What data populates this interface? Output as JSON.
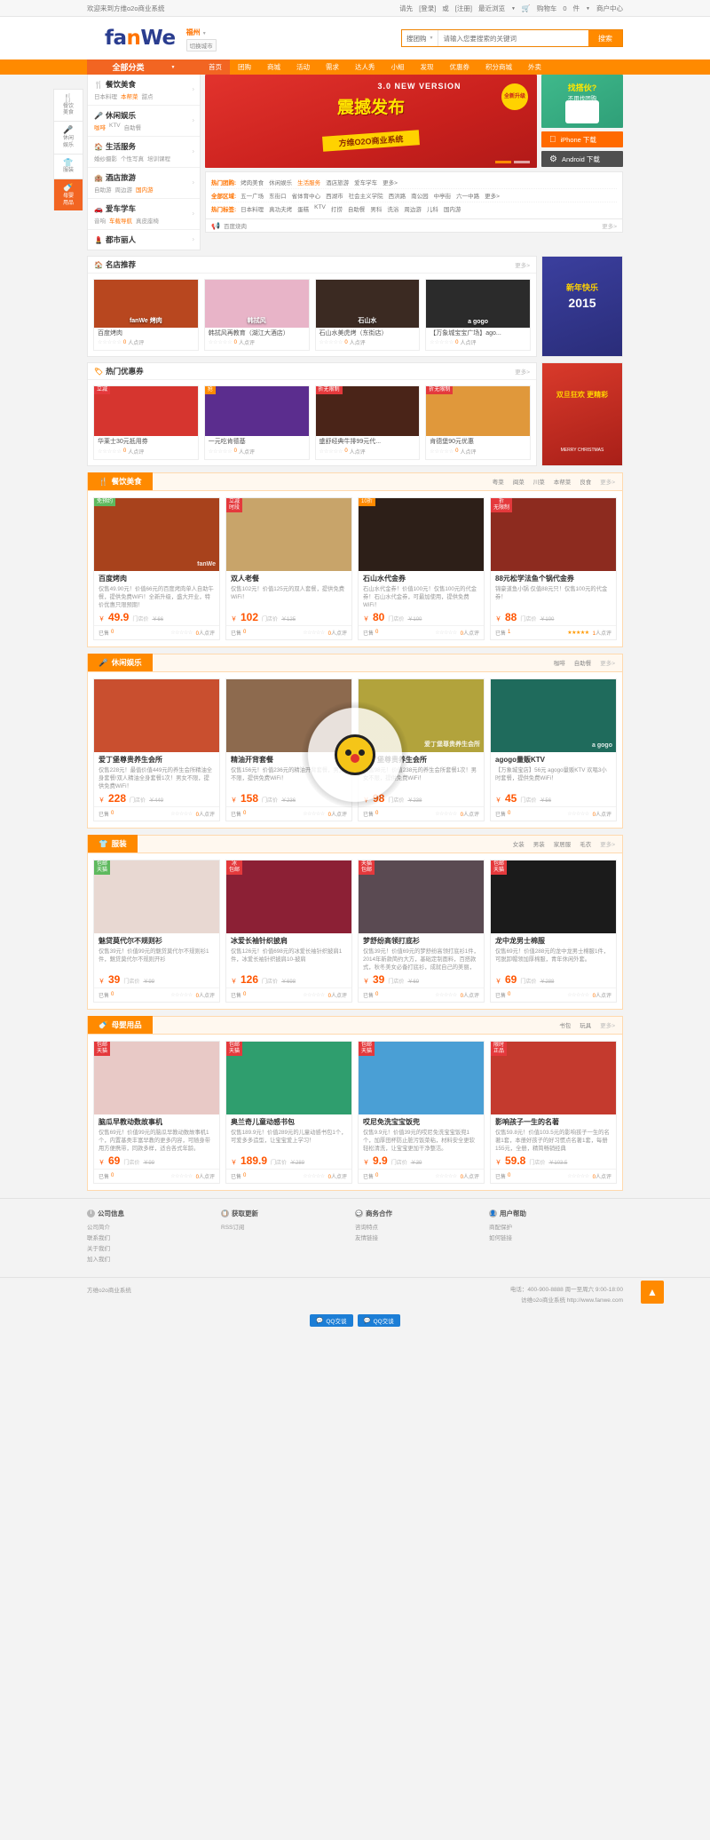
{
  "topbar": {
    "welcome": "欢迎来到方维o2o商业系统",
    "login_prefix": "请先",
    "login": "[登录]",
    "or": "或",
    "register": "[注册]",
    "recent": "最近浏览",
    "cart_label": "购物车",
    "cart_count": "0",
    "cart_unit": "件",
    "merchant_center": "商户中心"
  },
  "header": {
    "logo_a": "fa",
    "logo_o": "n",
    "logo_b": "We",
    "city": "福州",
    "switch_city": "切换城市",
    "search_type": "搜团购",
    "search_placeholder": "请输入您要搜索的关键词",
    "search_value": "",
    "search_button": "搜索"
  },
  "nav": {
    "all_categories": "全部分类",
    "items": [
      {
        "label": "首页",
        "active": true
      },
      {
        "label": "团购",
        "active": false
      },
      {
        "label": "商城",
        "active": false
      },
      {
        "label": "活动",
        "active": false
      },
      {
        "label": "需求",
        "active": false
      },
      {
        "label": "达人秀",
        "active": false
      },
      {
        "label": "小組",
        "active": false
      },
      {
        "label": "发现",
        "active": false
      },
      {
        "label": "优惠券",
        "active": false
      },
      {
        "label": "积分商城",
        "active": false
      },
      {
        "label": "外卖",
        "active": false
      }
    ]
  },
  "side_rail": [
    {
      "label": "餐饮美食",
      "icon": "🍴",
      "active": false
    },
    {
      "label": "休闲娱乐",
      "icon": "🎤",
      "active": false
    },
    {
      "label": "服装",
      "icon": "👕",
      "active": false
    },
    {
      "label": "母婴用品",
      "icon": "🍼",
      "active": true
    }
  ],
  "categories": [
    {
      "title": "餐饮美食",
      "icon": "🍴",
      "subs": [
        "日本料理",
        "本帮菜",
        "甜点"
      ],
      "hot_index": 1
    },
    {
      "title": "休闲娱乐",
      "icon": "🎤",
      "subs": [
        "咖啡",
        "KTV",
        "自助餐"
      ],
      "hot_index": 0
    },
    {
      "title": "生活服务",
      "icon": "🏠",
      "subs": [
        "婚纱摄影",
        "个性写真",
        "培训课程"
      ],
      "hot_index": -1
    },
    {
      "title": "酒店旅游",
      "icon": "🏨",
      "subs": [
        "自助游",
        "周边游",
        "国内游"
      ],
      "hot_index": 2
    },
    {
      "title": "爱车学车",
      "icon": "🚗",
      "subs": [
        "音响",
        "车载导航",
        "真皮座椅"
      ],
      "hot_index": 1
    },
    {
      "title": "都市丽人",
      "icon": "💄",
      "subs": [],
      "hot_index": -1
    }
  ],
  "banner": {
    "new_tag": "3.0 NEW VERSION",
    "title": "震撼发布",
    "subtitle": "方维O2O商业系统",
    "badge": "全新升级",
    "version": "3.0"
  },
  "right_ads": {
    "green_t1": "找搭伙?",
    "green_t2": "不用找团购",
    "ios_label": "iPhone 下载",
    "android_label": "Android 下载"
  },
  "hot_tags": {
    "rows": [
      {
        "label": "热门团购:",
        "tags": [
          "烤肉美食",
          "休闲娱乐",
          "生活服务",
          "酒店旅游",
          "爱车学车",
          "更多>"
        ],
        "on": 2
      },
      {
        "label": "全部区域:",
        "tags": [
          "五一广场",
          "东街口",
          "省体育中心",
          "西湖市",
          "社会主义学院",
          "西洪路",
          "南公园",
          "中亭街",
          "六一中路",
          "更多>"
        ],
        "on": -1
      },
      {
        "label": "热门标签:",
        "tags": [
          "日本料理",
          "真功夫烤",
          "蛋糕",
          "KTV",
          "打捞",
          "自助餐",
          "男科",
          "洗浴",
          "周边游",
          "儿科",
          "国内游"
        ],
        "on": -1
      }
    ],
    "notice": "百度烧肉",
    "notice_more": "更多>"
  },
  "shops": {
    "title": "名店推荐",
    "icon": "🏠",
    "more": "更多>",
    "cards": [
      {
        "name": "百度烤肉",
        "reviews": "0",
        "reviews_suffix": "人点评",
        "img": "#b8471f",
        "cap": "fanWe 烤肉"
      },
      {
        "name": "韩拭风再教育（湖江大酒店）",
        "reviews": "0",
        "reviews_suffix": "人点评",
        "img": "#e8b4c8",
        "cap": "韩拭风"
      },
      {
        "name": "石山水美虎烤（东街店）",
        "reviews": "0",
        "reviews_suffix": "人点评",
        "img": "#3b2a22",
        "cap": "石山水"
      },
      {
        "name": "【万象城宝宝广场】ago...",
        "reviews": "0",
        "reviews_suffix": "人点评",
        "img": "#2b2b2b",
        "cap": "a gogo"
      }
    ],
    "side_ad_title": "新年快乐",
    "side_ad_year": "2015"
  },
  "coupons": {
    "title": "热门优惠券",
    "icon": "🏷",
    "more": "更多>",
    "cards": [
      {
        "corner": "立减",
        "corner_color": "#e4393c",
        "name": "华莱士30元抵用券",
        "reviews": "0",
        "reviews_suffix": "人点评",
        "img": "#d6352f"
      },
      {
        "corner": "抢",
        "corner_color": "#ff8a00",
        "name": "一元吃肯德基",
        "reviews": "0",
        "reviews_suffix": "人点评",
        "img": "#5b2d8e"
      },
      {
        "corner": "折无限制",
        "corner_color": "#e4393c",
        "name": "盛舒经典牛排99元代...",
        "reviews": "0",
        "reviews_suffix": "人点评",
        "img": "#4a2418"
      },
      {
        "corner": "折无限制",
        "corner_color": "#e4393c",
        "name": "肯德堡90元优惠",
        "reviews": "0",
        "reviews_suffix": "人点评",
        "img": "#e0983b"
      }
    ],
    "side_ad_title": "双旦狂欢 更精彩",
    "side_ad_sub": "MERRY CHRISTMAS"
  },
  "sections": [
    {
      "id": "food",
      "title": "餐饮美食",
      "icon": "🍴",
      "filters": [
        "粤菜",
        "闽菜",
        "川菜",
        "本帮菜",
        "良食"
      ],
      "more": "更多>",
      "cards": [
        {
          "corner": "免预约",
          "corner_color": "#5eb95e",
          "title": "百度烤肉",
          "desc": "仅售49.90元！价值66元的百度烤肉单人自助午餐，提供免费WiFi！全新升级，盛大开业，特价优惠只限预期！",
          "price": "49.9",
          "old_label": "门店价",
          "old": "￥66",
          "sold_label": "已售",
          "sold": "0",
          "stars": 0,
          "reviews": "0",
          "reviews_suffix": "人点评",
          "img": "#a8421c",
          "cap": "fanWe"
        },
        {
          "corner": "立减 时段",
          "corner_color": "#e4393c",
          "title": "双人老餐",
          "desc": "仅售102元！价值125元的双人套餐，提供免费WiFi！",
          "price": "102",
          "old_label": "门店价",
          "old": "￥125",
          "sold_label": "已售",
          "sold": "0",
          "stars": 0,
          "reviews": "0",
          "reviews_suffix": "人点评",
          "img": "#c8a46a",
          "cap": ""
        },
        {
          "corner": "10折",
          "corner_color": "#ff8a00",
          "title": "石山水代金券",
          "desc": "石山水代金券！价值100元！仅售100元的代金券！石山水代金券，可最加使用，提供免费WiFi！",
          "price": "80",
          "old_label": "门店价",
          "old": "￥100",
          "sold_label": "已售",
          "sold": "0",
          "stars": 0,
          "reviews": "0",
          "reviews_suffix": "人点评",
          "img": "#2d1f18",
          "cap": ""
        },
        {
          "corner": "折 无限制",
          "corner_color": "#e4393c",
          "title": "88元松学法鱼个锅代金券",
          "desc": "锦豪道鱼小锅 仅值88元只！仅售100元的代金券！",
          "price": "88",
          "old_label": "门店价",
          "old": "￥100",
          "sold_label": "已售",
          "sold": "1",
          "stars": 5,
          "reviews": "1",
          "reviews_suffix": "人点评",
          "img": "#8d2b1f",
          "cap": ""
        }
      ]
    },
    {
      "id": "leisure",
      "title": "休闲娱乐",
      "icon": "🎤",
      "filters": [
        "咖啡",
        "自助餐"
      ],
      "more": "更多>",
      "cards": [
        {
          "corner": "",
          "corner_color": "",
          "title": "爱丁堡尊贵养生会所",
          "desc": "仅售228元！最值价值449元的养生会所精油全身套餐!双人精油全身套餐1次！男女不限，提供免费WiFi！",
          "price": "228",
          "old_label": "门店价",
          "old": "￥449",
          "sold_label": "已售",
          "sold": "0",
          "stars": 0,
          "reviews": "0",
          "reviews_suffix": "人点评",
          "img": "#c94f2f",
          "cap": ""
        },
        {
          "corner": "",
          "corner_color": "",
          "title": "精油开背套餐",
          "desc": "仅售156元！价值236元的精油开背套餐，男女不限，提供免费WiFi！",
          "price": "158",
          "old_label": "门店价",
          "old": "￥236",
          "sold_label": "已售",
          "sold": "0",
          "stars": 0,
          "reviews": "0",
          "reviews_suffix": "人点评",
          "img": "#8d6a4e",
          "cap": ""
        },
        {
          "corner": "",
          "corner_color": "",
          "title": "爱丁堡尊贵养生会所",
          "desc": "仅售98元！价值238元的养生会所套餐1次！男女不限，提供免费WiFi！",
          "price": "98",
          "old_label": "门店价",
          "old": "￥238",
          "sold_label": "已售",
          "sold": "0",
          "stars": 0,
          "reviews": "0",
          "reviews_suffix": "人点评",
          "img": "#b2a33c",
          "cap": "爱丁堡尊贵养生会所"
        },
        {
          "corner": "",
          "corner_color": "",
          "title": "agogo量贩KTV",
          "desc": "【万象城宝店】56元 agogo量贩KTV 欢唱3小时套餐，提供免费WiFi！",
          "price": "45",
          "old_label": "门店价",
          "old": "￥56",
          "sold_label": "已售",
          "sold": "0",
          "stars": 0,
          "reviews": "0",
          "reviews_suffix": "人点评",
          "img": "#1f6b5c",
          "cap": "a gogo"
        }
      ]
    },
    {
      "id": "clothes",
      "title": "服装",
      "icon": "👕",
      "filters": [
        "女装",
        "男装",
        "家居服",
        "毛衣"
      ],
      "more": "更多>",
      "cards": [
        {
          "corner": "包邮 天猫",
          "corner_color": "#5eb95e",
          "title": "魅贷莫代尔不规则衫",
          "desc": "仅售39元！价值99元的魅贷莫代尔不规则衫1件，魅贷莫代尔不规则开衫",
          "price": "39",
          "old_label": "门店价",
          "old": "￥99",
          "sold_label": "已售",
          "sold": "0",
          "stars": 0,
          "reviews": "0",
          "reviews_suffix": "人点评",
          "img": "#e8d8d2",
          "cap": ""
        },
        {
          "corner": "冰 包邮",
          "corner_color": "#e4393c",
          "title": "冰爱长袖针织披肩",
          "desc": "仅售126元！价值698元的冰爱长袖针织披肩1件，冰爱长袖针织披肩10-披肩",
          "price": "126",
          "old_label": "门店价",
          "old": "￥698",
          "sold_label": "已售",
          "sold": "0",
          "stars": 0,
          "reviews": "0",
          "reviews_suffix": "人点评",
          "img": "#8c2035",
          "cap": ""
        },
        {
          "corner": "天猫 包邮",
          "corner_color": "#e4393c",
          "title": "梦舒纷高领打底衫",
          "desc": "仅售39元！价值69元的梦舒纷高领打底衫1件，2014年新款简约大方，基础定制面料，百搭款式，秋冬美女必备打底衫，成就自己的美丽，就",
          "price": "39",
          "old_label": "门店价",
          "old": "￥69",
          "sold_label": "已售",
          "sold": "0",
          "stars": 0,
          "reviews": "0",
          "reviews_suffix": "人点评",
          "img": "#5a4a52",
          "cap": ""
        },
        {
          "corner": "包邮 天猫",
          "corner_color": "#e4393c",
          "title": "龙中龙男士棉服",
          "desc": "仅售69元！价值288元的龙中龙男士棉服1件，可脱卸帽领加厚棉服，青年休闲外套。",
          "price": "69",
          "old_label": "门店价",
          "old": "￥288",
          "sold_label": "已售",
          "sold": "0",
          "stars": 0,
          "reviews": "0",
          "reviews_suffix": "人点评",
          "img": "#1b1b1b",
          "cap": ""
        }
      ]
    },
    {
      "id": "baby",
      "title": "母婴用品",
      "icon": "🍼",
      "filters": [
        "书包",
        "玩具"
      ],
      "more": "更多>",
      "cards": [
        {
          "corner": "包邮 天猫",
          "corner_color": "#e4393c",
          "title": "脑瓜早教动数故事机",
          "desc": "仅售69元！价值99元的脑瓜早教动数故事机1个，内置基类丰富早教的更多内容，可随身带用方便携带，同款多样，适合各式年龄。",
          "price": "69",
          "old_label": "门店价",
          "old": "￥99",
          "sold_label": "已售",
          "sold": "0",
          "stars": 0,
          "reviews": "0",
          "reviews_suffix": "人点评",
          "img": "#e8c9c6",
          "cap": ""
        },
        {
          "corner": "包邮 天猫",
          "corner_color": "#e4393c",
          "title": "奥兰奇儿童动感书包",
          "desc": "仅售189.9元！价值289元的儿童动感书包1个，可爱多多造型，让宝宝爱上学习！",
          "price": "189.9",
          "old_label": "门店价",
          "old": "￥289",
          "sold_label": "已售",
          "sold": "0",
          "stars": 0,
          "reviews": "0",
          "reviews_suffix": "人点评",
          "img": "#2f9e6e",
          "cap": ""
        },
        {
          "corner": "包邮 天猫",
          "corner_color": "#e4393c",
          "title": "哎尼免洗宝宝饭兜",
          "desc": "仅售9.9元！价值39元的哎尼免洗宝宝饭兜1个，加厚田杯防止脏污饭菜粘，材料安全更软轻松清洗，让宝宝更加干净整洁。",
          "price": "9.9",
          "old_label": "门店价",
          "old": "￥39",
          "sold_label": "已售",
          "sold": "0",
          "stars": 0,
          "reviews": "0",
          "reviews_suffix": "人点评",
          "img": "#4a9fd5",
          "cap": ""
        },
        {
          "corner": "限时 正品",
          "corner_color": "#e4393c",
          "title": "影响孩子一生的名著",
          "desc": "仅售59.8元！价值103.5元的影响孩子一生的名著1套，本册好孩子的好习惯点名著1套，每册155元，全册，精简畅销经典",
          "price": "59.8",
          "old_label": "门店价",
          "old": "￥103.5",
          "sold_label": "已售",
          "sold": "0",
          "stars": 0,
          "reviews": "0",
          "reviews_suffix": "人点评",
          "img": "#c43a2e",
          "cap": ""
        }
      ]
    }
  ],
  "footer": {
    "columns": [
      {
        "icon": "i",
        "title": "公司信息",
        "links": [
          "公司简介",
          "联系我们",
          "关于我们",
          "加入我们"
        ]
      },
      {
        "icon": "📋",
        "title": "获取更新",
        "links": [
          "RSS订阅"
        ]
      },
      {
        "icon": "💬",
        "title": "商务合作",
        "links": [
          "咨询特点",
          "友情链接"
        ]
      },
      {
        "icon": "👤",
        "title": "用户帮助",
        "links": [
          "商配保护",
          "如何链接"
        ]
      }
    ],
    "brand": "方维o2o商业系统",
    "phone_label": "电话：",
    "phone": "400-900-8888",
    "hours": "周一至周六 9:00-18:00",
    "site_label": "访维o2o商业系统",
    "site_url": "http://www.fanwe.com",
    "qq1": "QQ交谈",
    "qq2": "QQ交谈",
    "totop": "▲"
  }
}
